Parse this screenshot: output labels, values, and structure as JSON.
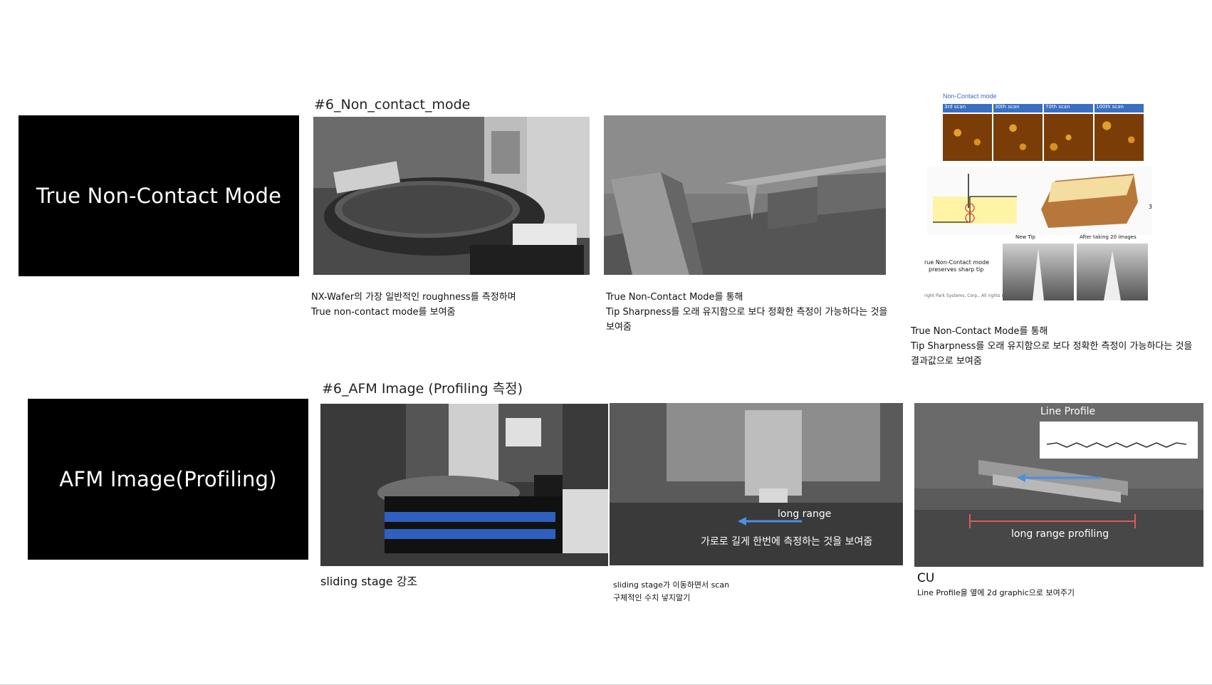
{
  "row1": {
    "card_title": "True Non-Contact Mode",
    "section_title": "#6_Non_contact_mode",
    "captions": {
      "c1": [
        "NX-Wafer의 가장 일반적인 roughness를 측정하며",
        "True non-contact mode를 보여줌"
      ],
      "c2": [
        "True Non-Contact Mode를 통해",
        "Tip Sharpness를 오래 유지함으로 보다 정확한 측정이 가능하다는 것을",
        "보여줌"
      ],
      "c3": [
        "True Non-Contact Mode를 통해",
        "Tip Sharpness를 오래 유지함으로 보다 정확한 측정이 가능하다는 것을",
        "결과값으로 보여줌"
      ]
    },
    "figure": {
      "header": "Non-Contact mode",
      "scans": [
        "3rd scan",
        "30th scan",
        "70th scan",
        "100th scan"
      ],
      "new_tip": "New Tip",
      "after": "After taking 20 images",
      "note1": "rue Non-Contact mode",
      "note2": "preserves sharp tip",
      "copyright": "right Park Systems, Corp., All rights r",
      "axis_label": "3"
    }
  },
  "row2": {
    "card_title": "AFM Image(Profiling)",
    "section_title": "#6_AFM Image (Profiling 측정)",
    "captions": {
      "c1": "sliding stage 강조",
      "c2": [
        "sliding stage가 이동하면서 scan",
        "구체적인 수치 넣지말기"
      ],
      "c3_title": "CU",
      "c3": "Line Profile을 옆에 2d graphic으로 보여주기"
    },
    "overlays": {
      "long_range": "long range",
      "horizontal_note": "가로로 길게 한번에 측정하는 것을 보여줌",
      "line_profile": "Line Profile",
      "long_range_profiling": "long range profiling"
    }
  },
  "colors": {
    "card_bg": "#000000",
    "arrow_blue": "#4a90e2",
    "red_marker": "#e05a5a",
    "blue_band": "#2f5fc0"
  }
}
